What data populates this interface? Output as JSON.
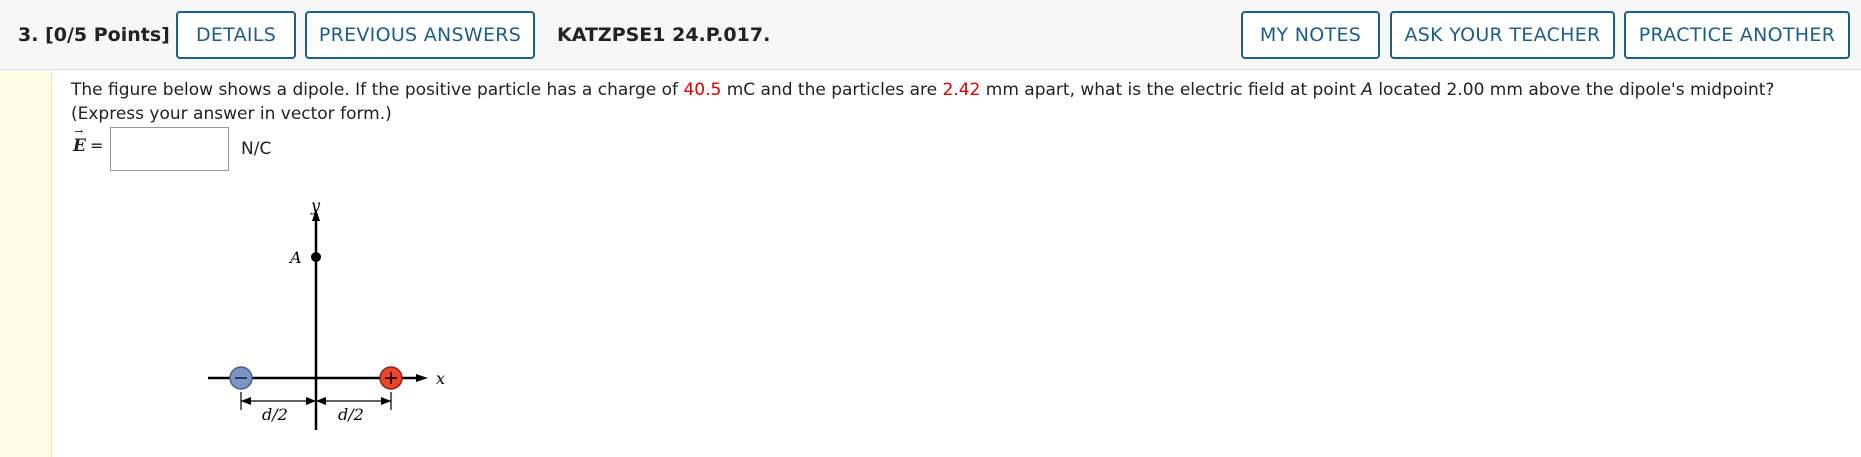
{
  "header": {
    "question_number": "3.",
    "points": "[0/5 Points]",
    "details_label": "DETAILS",
    "previous_answers_label": "PREVIOUS ANSWERS",
    "problem_code": "KATZPSE1 24.P.017.",
    "my_notes_label": "MY NOTES",
    "ask_teacher_label": "ASK YOUR TEACHER",
    "practice_another_label": "PRACTICE ANOTHER"
  },
  "question": {
    "text_1": "The figure below shows a dipole. If the positive particle has a charge of ",
    "charge": "40.5",
    "text_2": " mC and the particles are ",
    "separation": "2.42",
    "text_3": " mm apart, what is the electric field at point ",
    "point": "A",
    "text_4": " located 2.00 mm above the dipole's midpoint? (Express your answer in vector form.)"
  },
  "answer": {
    "label": "E",
    "equals": "=",
    "value": "",
    "unit": "N/C"
  },
  "figure": {
    "y_axis_label": "y",
    "x_axis_label": "x",
    "point_label": "A",
    "left_dim_label": "d/2",
    "right_dim_label": "d/2",
    "positive_sign": "+",
    "negative_sign": "−",
    "positive_color": "#e8452c",
    "negative_color": "#7b96c4"
  },
  "colors": {
    "accent": "#1f5d85",
    "highlight_red": "#d40000",
    "sidebar": "#fdfde1"
  }
}
